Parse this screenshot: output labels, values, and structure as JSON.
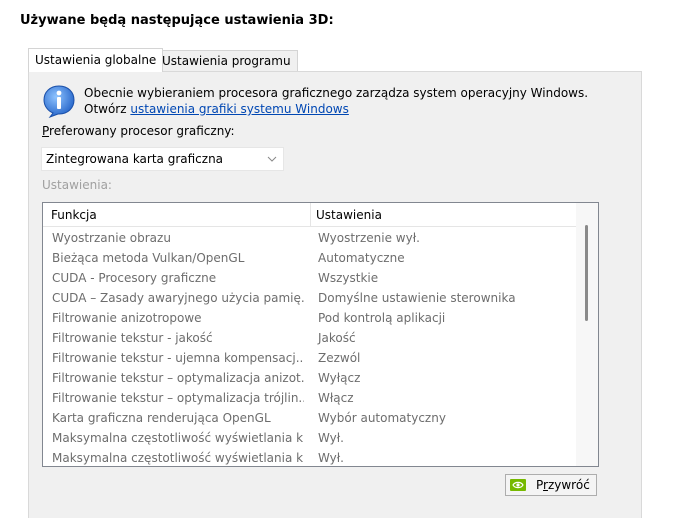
{
  "heading": "Używane będą następujące ustawienia 3D:",
  "tabs": [
    {
      "label": "Ustawienia globalne",
      "active": true
    },
    {
      "label": "Ustawienia programu",
      "active": false
    }
  ],
  "info": {
    "icon": "info-icon",
    "line1": "Obecnie wybieraniem procesora graficznego zarządza system operacyjny Windows.",
    "line2_prefix": "Otwórz",
    "link": "ustawienia grafiki systemu Windows"
  },
  "preferred": {
    "label": "Preferowany procesor graficzny:",
    "selected": "Zintegrowana karta graficzna"
  },
  "settings_label": "Ustawienia:",
  "table": {
    "columns": [
      "Funkcja",
      "Ustawienia"
    ],
    "rows": [
      [
        "Wyostrzanie obrazu",
        "Wyostrzenie wył."
      ],
      [
        "Bieżąca metoda Vulkan/OpenGL",
        "Automatyczne"
      ],
      [
        "CUDA - Procesory graficzne",
        "Wszystkie"
      ],
      [
        "CUDA – Zasady awaryjnego użycia pamię...",
        "Domyślne ustawienie sterownika"
      ],
      [
        "Filtrowanie anizotropowe",
        "Pod kontrolą aplikacji"
      ],
      [
        "Filtrowanie tekstur - jakość",
        "Jakość"
      ],
      [
        "Filtrowanie tekstur - ujemna kompensacj...",
        "Zezwól"
      ],
      [
        "Filtrowanie tekstur – optymalizacja anizot...",
        "Wyłącz"
      ],
      [
        "Filtrowanie tekstur – optymalizacja trójlin...",
        "Włącz"
      ],
      [
        "Karta graficzna renderująca OpenGL",
        "Wybór automatyczny"
      ],
      [
        "Maksymalna częstotliwość wyświetlania k...",
        "Wył."
      ],
      [
        "Maksymalna częstotliwość wyświetlania k...",
        "Wył."
      ]
    ]
  },
  "restore_button": "Przywróć",
  "colors": {
    "link": "#0047b3",
    "nvidia_green": "#76b900",
    "panel_bg": "#f0f0f0"
  }
}
